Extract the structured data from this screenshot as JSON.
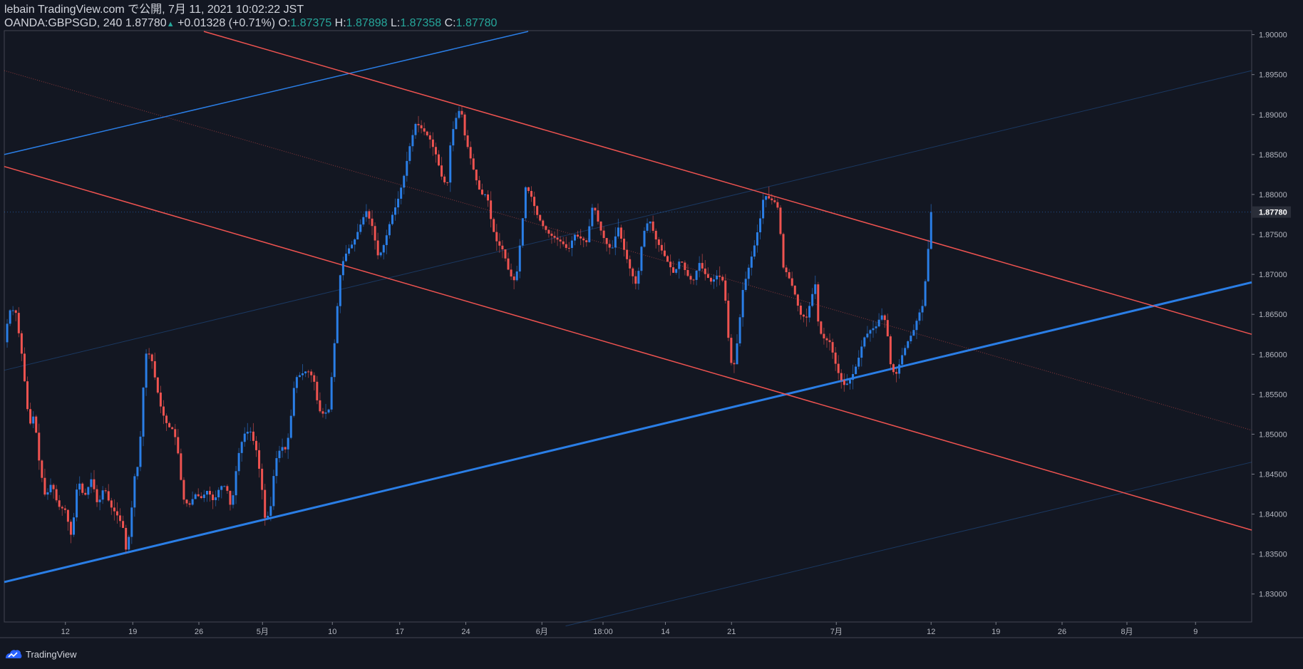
{
  "header": {
    "line1": "lebain TradingView.com で公開, 7月 11, 2021 10:02:22 JST",
    "symbol": "OANDA:GBPSGD, 240",
    "last": "1.87780",
    "change": "+0.01328 (+0.71%)",
    "o_label": "O:",
    "o": "1.87375",
    "h_label": "H:",
    "h": "1.87898",
    "l_label": "L:",
    "l": "1.87358",
    "c_label": "C:",
    "c": "1.87780"
  },
  "footer": {
    "brand": "TradingView",
    "logo_icon": "tradingview-logo-icon"
  },
  "colors": {
    "bg": "#131722",
    "up": "#2a7ee6",
    "down": "#ef5350",
    "trend_blue": "#2a7ee6",
    "trend_red": "#ef5350",
    "text": "#d1d4dc",
    "grid": "#2a2e39"
  },
  "chart_data": {
    "type": "candlestick",
    "symbol": "OANDA:GBPSGD",
    "ylim": [
      1.8265,
      1.9005
    ],
    "y_ticks": [
      "1.83000",
      "1.83500",
      "1.84000",
      "1.84500",
      "1.85000",
      "1.85500",
      "1.86000",
      "1.86500",
      "1.87000",
      "1.87500",
      "1.88000",
      "1.88500",
      "1.89000",
      "1.89500",
      "1.90000"
    ],
    "x_ticks": [
      {
        "label": "12",
        "x": 0.049
      },
      {
        "label": "19",
        "x": 0.103
      },
      {
        "label": "26",
        "x": 0.156
      },
      {
        "label": "5月",
        "x": 0.207
      },
      {
        "label": "10",
        "x": 0.263
      },
      {
        "label": "17",
        "x": 0.317
      },
      {
        "label": "24",
        "x": 0.37
      },
      {
        "label": "6月",
        "x": 0.431
      },
      {
        "label": "18:00",
        "x": 0.48
      },
      {
        "label": "14",
        "x": 0.53
      },
      {
        "label": "21",
        "x": 0.583
      },
      {
        "label": "7月",
        "x": 0.667
      },
      {
        "label": "12",
        "x": 0.743
      },
      {
        "label": "19",
        "x": 0.795
      },
      {
        "label": "26",
        "x": 0.848
      },
      {
        "label": "8月",
        "x": 0.9
      },
      {
        "label": "9",
        "x": 0.955
      }
    ],
    "last_price": 1.8778,
    "last_price_label": "1.87780",
    "price_path": [
      [
        0.0,
        1.8615
      ],
      [
        0.004,
        1.8655
      ],
      [
        0.009,
        1.8655
      ],
      [
        0.014,
        1.86
      ],
      [
        0.02,
        1.851
      ],
      [
        0.024,
        1.8525
      ],
      [
        0.028,
        1.8465
      ],
      [
        0.033,
        1.842
      ],
      [
        0.038,
        1.844
      ],
      [
        0.043,
        1.841
      ],
      [
        0.049,
        1.8405
      ],
      [
        0.054,
        1.837
      ],
      [
        0.059,
        1.8445
      ],
      [
        0.064,
        1.842
      ],
      [
        0.07,
        1.8445
      ],
      [
        0.075,
        1.841
      ],
      [
        0.08,
        1.8435
      ],
      [
        0.085,
        1.841
      ],
      [
        0.09,
        1.84
      ],
      [
        0.095,
        1.8385
      ],
      [
        0.098,
        1.835
      ],
      [
        0.101,
        1.8385
      ],
      [
        0.104,
        1.8445
      ],
      [
        0.108,
        1.8465
      ],
      [
        0.111,
        1.855
      ],
      [
        0.114,
        1.8605
      ],
      [
        0.118,
        1.8595
      ],
      [
        0.122,
        1.856
      ],
      [
        0.126,
        1.853
      ],
      [
        0.131,
        1.851
      ],
      [
        0.136,
        1.8505
      ],
      [
        0.14,
        1.847
      ],
      [
        0.143,
        1.842
      ],
      [
        0.148,
        1.841
      ],
      [
        0.153,
        1.8425
      ],
      [
        0.158,
        1.842
      ],
      [
        0.163,
        1.843
      ],
      [
        0.168,
        1.8415
      ],
      [
        0.173,
        1.8435
      ],
      [
        0.178,
        1.8435
      ],
      [
        0.182,
        1.8405
      ],
      [
        0.187,
        1.847
      ],
      [
        0.192,
        1.85
      ],
      [
        0.197,
        1.8505
      ],
      [
        0.202,
        1.848
      ],
      [
        0.206,
        1.844
      ],
      [
        0.209,
        1.8395
      ],
      [
        0.213,
        1.84
      ],
      [
        0.217,
        1.8465
      ],
      [
        0.222,
        1.8485
      ],
      [
        0.226,
        1.848
      ],
      [
        0.229,
        1.851
      ],
      [
        0.233,
        1.857
      ],
      [
        0.238,
        1.8575
      ],
      [
        0.243,
        1.858
      ],
      [
        0.248,
        1.857
      ],
      [
        0.252,
        1.853
      ],
      [
        0.256,
        1.8525
      ],
      [
        0.26,
        1.853
      ],
      [
        0.264,
        1.86
      ],
      [
        0.267,
        1.866
      ],
      [
        0.27,
        1.871
      ],
      [
        0.275,
        1.873
      ],
      [
        0.28,
        1.874
      ],
      [
        0.285,
        1.876
      ],
      [
        0.29,
        1.878
      ],
      [
        0.295,
        1.876
      ],
      [
        0.3,
        1.872
      ],
      [
        0.305,
        1.874
      ],
      [
        0.31,
        1.877
      ],
      [
        0.315,
        1.879
      ],
      [
        0.32,
        1.882
      ],
      [
        0.325,
        1.886
      ],
      [
        0.33,
        1.889
      ],
      [
        0.336,
        1.888
      ],
      [
        0.341,
        1.887
      ],
      [
        0.346,
        1.885
      ],
      [
        0.351,
        1.882
      ],
      [
        0.355,
        1.881
      ],
      [
        0.358,
        1.887
      ],
      [
        0.362,
        1.8895
      ],
      [
        0.366,
        1.891
      ],
      [
        0.369,
        1.8875
      ],
      [
        0.373,
        1.885
      ],
      [
        0.378,
        1.882
      ],
      [
        0.382,
        1.88
      ],
      [
        0.387,
        1.88
      ],
      [
        0.391,
        1.876
      ],
      [
        0.395,
        1.874
      ],
      [
        0.4,
        1.873
      ],
      [
        0.405,
        1.87
      ],
      [
        0.41,
        1.869
      ],
      [
        0.415,
        1.876
      ],
      [
        0.418,
        1.881
      ],
      [
        0.422,
        1.88
      ],
      [
        0.427,
        1.8775
      ],
      [
        0.432,
        1.876
      ],
      [
        0.437,
        1.875
      ],
      [
        0.442,
        1.8745
      ],
      [
        0.447,
        1.874
      ],
      [
        0.452,
        1.873
      ],
      [
        0.457,
        1.875
      ],
      [
        0.462,
        1.8745
      ],
      [
        0.467,
        1.874
      ],
      [
        0.472,
        1.879
      ],
      [
        0.477,
        1.876
      ],
      [
        0.482,
        1.874
      ],
      [
        0.487,
        1.873
      ],
      [
        0.492,
        1.876
      ],
      [
        0.497,
        1.873
      ],
      [
        0.502,
        1.8705
      ],
      [
        0.507,
        1.8685
      ],
      [
        0.512,
        1.875
      ],
      [
        0.517,
        1.877
      ],
      [
        0.522,
        1.8745
      ],
      [
        0.527,
        1.873
      ],
      [
        0.532,
        1.8715
      ],
      [
        0.537,
        1.87
      ],
      [
        0.542,
        1.872
      ],
      [
        0.547,
        1.87
      ],
      [
        0.552,
        1.869
      ],
      [
        0.557,
        1.8715
      ],
      [
        0.562,
        1.87
      ],
      [
        0.567,
        1.869
      ],
      [
        0.572,
        1.87
      ],
      [
        0.577,
        1.869
      ],
      [
        0.581,
        1.861
      ],
      [
        0.584,
        1.8575
      ],
      [
        0.588,
        1.862
      ],
      [
        0.592,
        1.868
      ],
      [
        0.597,
        1.871
      ],
      [
        0.602,
        1.874
      ],
      [
        0.606,
        1.877
      ],
      [
        0.609,
        1.88
      ],
      [
        0.613,
        1.8795
      ],
      [
        0.618,
        1.879
      ],
      [
        0.621,
        1.878
      ],
      [
        0.624,
        1.871
      ],
      [
        0.628,
        1.87
      ],
      [
        0.633,
        1.868
      ],
      [
        0.638,
        1.865
      ],
      [
        0.643,
        1.8645
      ],
      [
        0.647,
        1.867
      ],
      [
        0.65,
        1.869
      ],
      [
        0.653,
        1.863
      ],
      [
        0.657,
        1.862
      ],
      [
        0.662,
        1.8615
      ],
      [
        0.666,
        1.859
      ],
      [
        0.67,
        1.857
      ],
      [
        0.674,
        1.856
      ],
      [
        0.679,
        1.857
      ],
      [
        0.684,
        1.859
      ],
      [
        0.689,
        1.862
      ],
      [
        0.694,
        1.863
      ],
      [
        0.699,
        1.8635
      ],
      [
        0.703,
        1.865
      ],
      [
        0.707,
        1.864
      ],
      [
        0.711,
        1.858
      ],
      [
        0.715,
        1.8575
      ],
      [
        0.72,
        1.86
      ],
      [
        0.724,
        1.8615
      ],
      [
        0.729,
        1.863
      ],
      [
        0.733,
        1.865
      ],
      [
        0.736,
        1.866
      ],
      [
        0.739,
        1.87
      ],
      [
        0.741,
        1.8738
      ],
      [
        0.743,
        1.8778
      ]
    ],
    "trendlines": [
      {
        "name": "blue-trend-upper",
        "color": "#2a7ee6",
        "width": 1.5,
        "style": "solid",
        "x1": 0.0,
        "y1": 1.885,
        "x2": 0.42,
        "y2": 1.9004
      },
      {
        "name": "blue-trend-lower",
        "color": "#2a7ee6",
        "width": 3,
        "style": "solid",
        "x1": 0.0,
        "y1": 1.8315,
        "x2": 1.0,
        "y2": 1.869
      },
      {
        "name": "blue-trend-faint-mid",
        "color": "#2a7ee6",
        "width": 1,
        "style": "faint",
        "x1": 0.0,
        "y1": 1.858,
        "x2": 1.0,
        "y2": 1.8955
      },
      {
        "name": "blue-trend-faint-low",
        "color": "#2a7ee6",
        "width": 1,
        "style": "faint",
        "x1": 0.45,
        "y1": 1.826,
        "x2": 1.0,
        "y2": 1.8465
      },
      {
        "name": "red-trend-upper",
        "color": "#ef5350",
        "width": 1.5,
        "style": "solid",
        "x1": 0.16,
        "y1": 1.9004,
        "x2": 1.0,
        "y2": 1.8625
      },
      {
        "name": "red-trend-lower",
        "color": "#ef5350",
        "width": 1.5,
        "style": "solid",
        "x1": 0.0,
        "y1": 1.8835,
        "x2": 1.0,
        "y2": 1.838
      },
      {
        "name": "red-trend-dotted-mid",
        "color": "#ef5350",
        "width": 1,
        "style": "dotted",
        "x1": 0.0,
        "y1": 1.8955,
        "x2": 1.0,
        "y2": 1.8505
      }
    ]
  }
}
